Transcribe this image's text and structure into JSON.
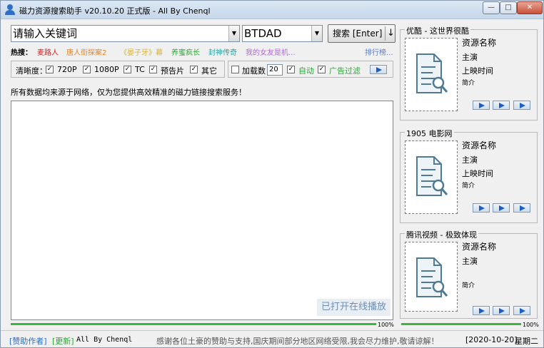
{
  "window": {
    "title": "磁力资源搜索助手 v20.10.20 正式版 - All By Chenql",
    "min": "—",
    "max": "□",
    "close": "✕"
  },
  "search": {
    "keyword": "请输入关键词",
    "engine": "BTDAD",
    "button": "搜索 [Enter]",
    "button_extra": "↓"
  },
  "hot": {
    "label": "热搜：",
    "items": [
      {
        "text": "麦路人",
        "color": "#d21f1f"
      },
      {
        "text": "唐人街探案2",
        "color": "#e0862a"
      },
      {
        "text": "《晏子牙》幕",
        "color": "#d7b33a"
      },
      {
        "text": "养蜜疯长",
        "color": "#31a83a"
      },
      {
        "text": "封神传奇",
        "color": "#2aa3a3"
      },
      {
        "text": "我的女友是机...",
        "color": "#b06ad2"
      }
    ],
    "ranking": "排行榜..."
  },
  "filter": {
    "label": "清晰度：",
    "options": [
      {
        "label": "720P",
        "checked": true
      },
      {
        "label": "1080P",
        "checked": true
      },
      {
        "label": "TC",
        "checked": true
      },
      {
        "label": "预告片",
        "checked": true
      },
      {
        "label": "其它",
        "checked": true
      }
    ]
  },
  "load": {
    "label": "加载数",
    "checked": false,
    "count": "20",
    "auto_label": "自动",
    "auto_checked": true,
    "ad_label": "广告过滤",
    "ad_checked": true
  },
  "notice": "所有数据均来源于网络，仅为您提供高效精准的磁力链接搜索服务！",
  "results": {
    "open_play": "已打开在线播放"
  },
  "progress": {
    "main": "100%",
    "side": "100%"
  },
  "panels": [
    {
      "title": "优酷 - 这世界很酷",
      "name": "资源名称",
      "star": "主演",
      "date": "上映时间",
      "desc": "简介"
    },
    {
      "title": "1905 电影网",
      "name": "资源名称",
      "star": "主演",
      "date": "上映时间",
      "desc": "简介"
    },
    {
      "title": "腾讯视频 - 极致体现",
      "name": "资源名称",
      "star": "主演",
      "date": "",
      "desc": "简介"
    }
  ],
  "status": {
    "sponsor": "[赞助作者]",
    "update": "[更新]",
    "author": "All By Chenql",
    "message": "感谢各位土豪的赞助与支持,国庆期间部分地区网络受限,我会尽力维护,敬请谅解！",
    "date": "[2020-10-20]",
    "weekday": "星期二"
  }
}
